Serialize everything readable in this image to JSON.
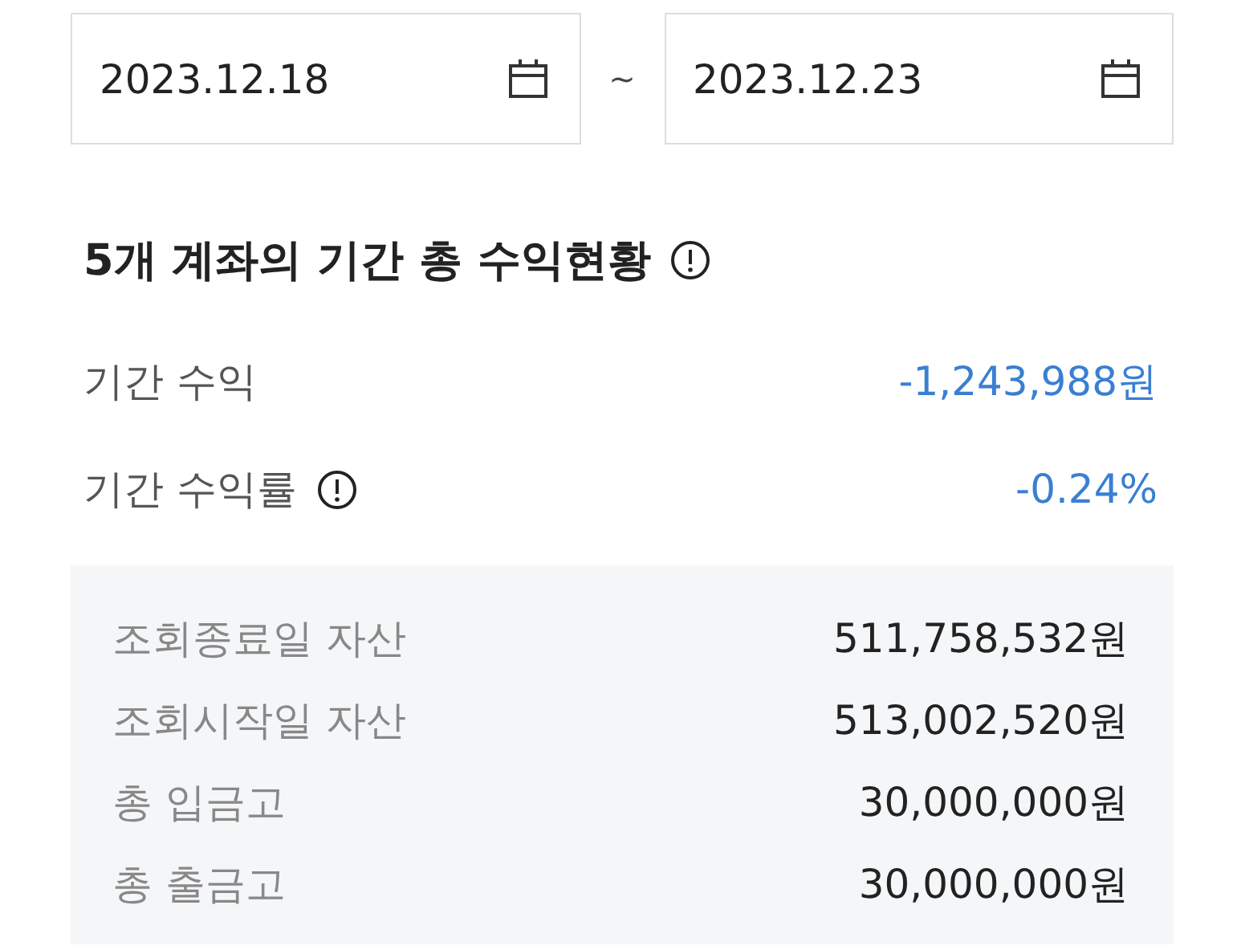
{
  "date_range": {
    "start": "2023.12.18",
    "separator": "~",
    "end": "2023.12.23"
  },
  "summary": {
    "title": "5개 계좌의 기간 총 수익현황",
    "title_info": true,
    "rows": [
      {
        "label": "기간 수익",
        "value": "-1,243,988원",
        "info": false
      },
      {
        "label": "기간 수익률",
        "value": "-0.24%",
        "info": true
      }
    ]
  },
  "details": [
    {
      "label": "조회종료일 자산",
      "value": "511,758,532원"
    },
    {
      "label": "조회시작일 자산",
      "value": "513,002,520원"
    },
    {
      "label": "총 입금고",
      "value": "30,000,000원"
    },
    {
      "label": "총 출금고",
      "value": "30,000,000원"
    }
  ]
}
